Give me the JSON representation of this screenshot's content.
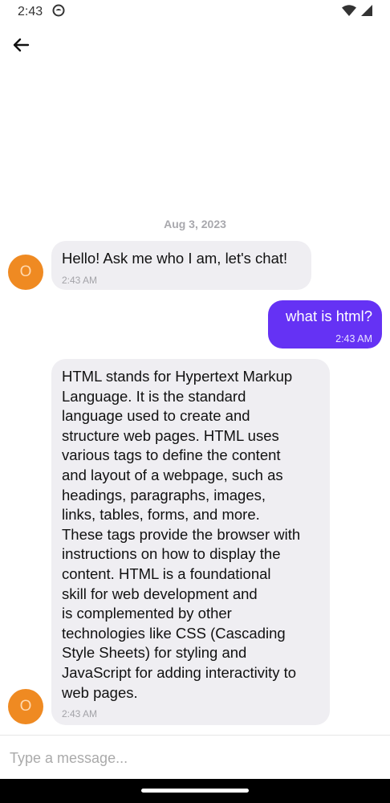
{
  "status_bar": {
    "time": "2:43"
  },
  "conversation": {
    "date_label": "Aug 3, 2023",
    "avatar_letter": "O",
    "messages": [
      {
        "sender": "bot",
        "text": "Hello! Ask me who I am, let's chat!",
        "time": "2:43 AM"
      },
      {
        "sender": "user",
        "text": "what is html?",
        "time": "2:43 AM"
      },
      {
        "sender": "bot",
        "lines": [
          "HTML stands for Hypertext Markup",
          "Language. It is the standard",
          "language used to create and",
          "structure web pages. HTML uses",
          "various tags to define the content",
          "and layout of a webpage, such as",
          "headings, paragraphs, images,",
          "links, tables, forms, and more.",
          "These tags provide the browser with",
          "instructions on how to display the",
          "content. HTML is a foundational",
          "skill for web development and",
          "is complemented by other",
          "technologies like CSS (Cascading",
          "Style Sheets) for styling and",
          "JavaScript for adding interactivity to",
          "web pages."
        ],
        "time": "2:43 AM"
      }
    ]
  },
  "composer": {
    "placeholder": "Type a message..."
  },
  "colors": {
    "accent": "#6532f4",
    "avatar": "#ef8a22",
    "incoming_bubble": "#efeef2"
  }
}
